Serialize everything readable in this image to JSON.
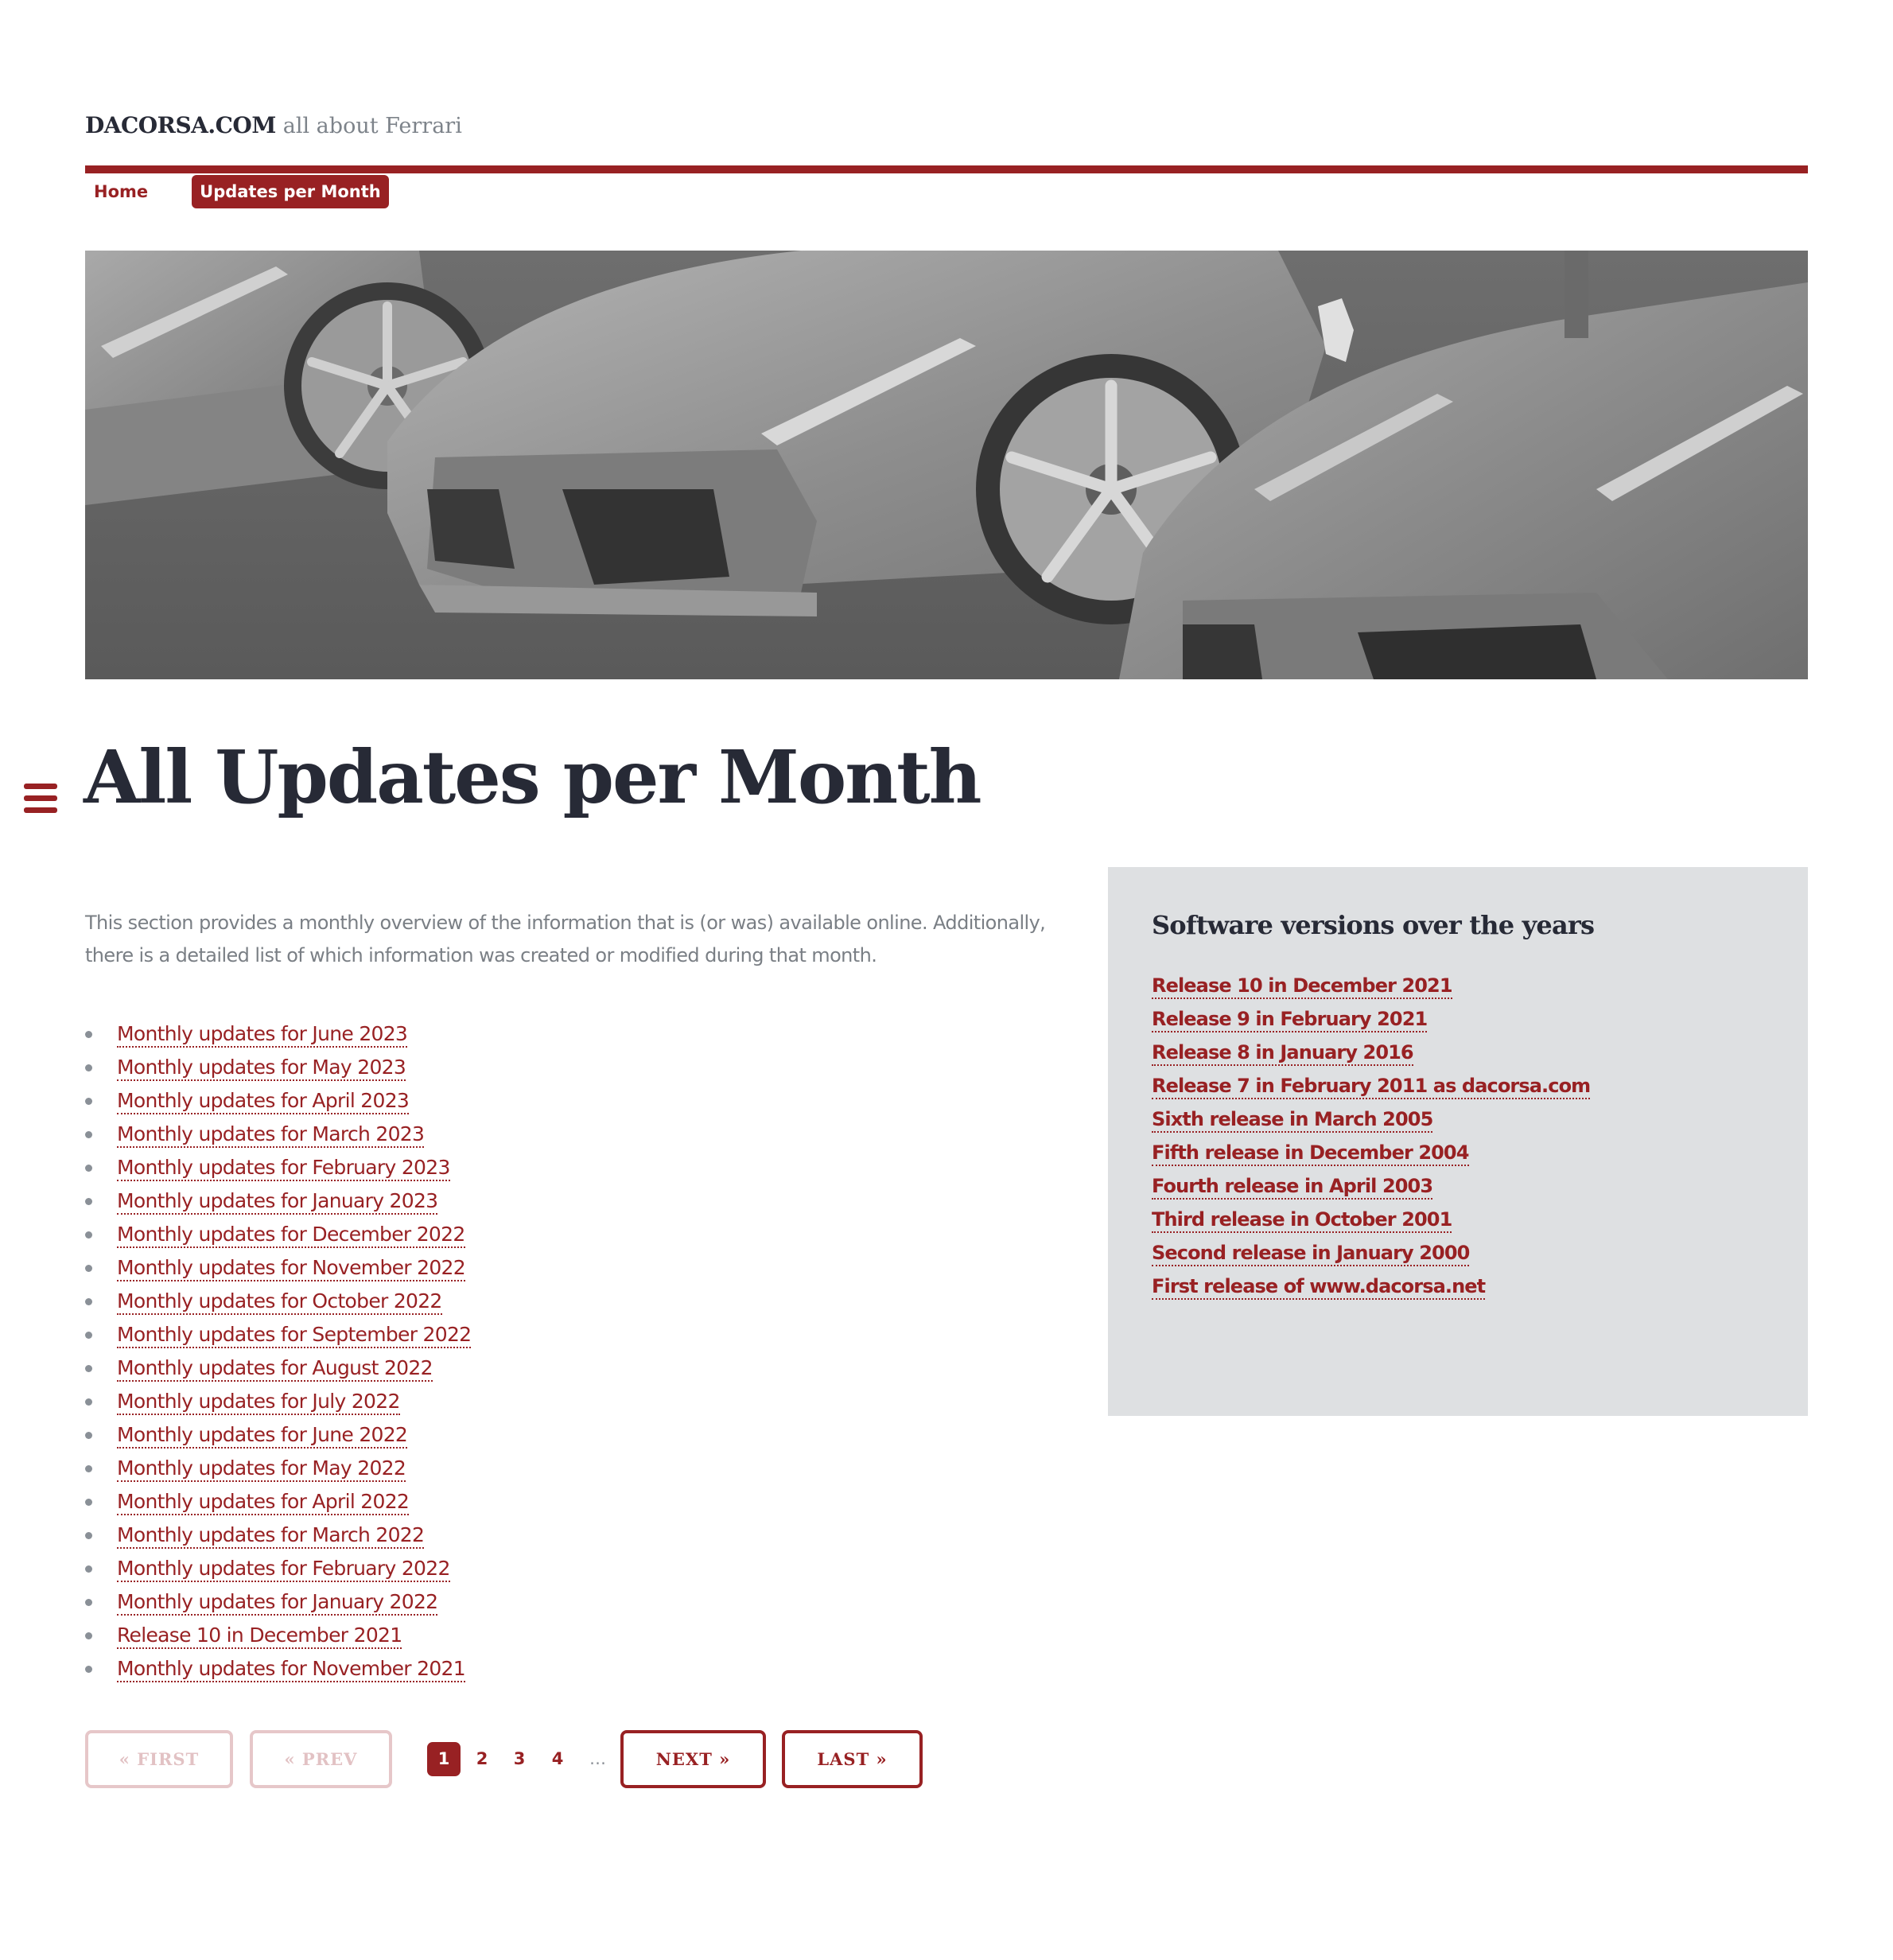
{
  "header": {
    "brand": "DACORSA.COM",
    "tagline": "all about Ferrari"
  },
  "nav": {
    "items": [
      {
        "label": "Home",
        "active": false
      },
      {
        "label": "Updates per Month",
        "active": true
      }
    ]
  },
  "hero": {
    "alt": "Grayscale photo of several Ferrari Enzo cars parked in a row"
  },
  "page": {
    "title": "All Updates per Month",
    "menu_icon": "hamburger-menu-icon",
    "intro": "This section provides a monthly overview of the information that is (or was) available online. Additionally, there is a detailed list of which information was created or modified during that month."
  },
  "monthly_updates": [
    "Monthly updates for June 2023",
    "Monthly updates for May 2023",
    "Monthly updates for April 2023",
    "Monthly updates for March 2023",
    "Monthly updates for February 2023",
    "Monthly updates for January 2023",
    "Monthly updates for December 2022",
    "Monthly updates for November 2022",
    "Monthly updates for October 2022",
    "Monthly updates for September 2022",
    "Monthly updates for August 2022",
    "Monthly updates for July 2022",
    "Monthly updates for June 2022",
    "Monthly updates for May 2022",
    "Monthly updates for April 2022",
    "Monthly updates for March 2022",
    "Monthly updates for February 2022",
    "Monthly updates for January 2022",
    "Release 10 in December 2021",
    "Monthly updates for November 2021"
  ],
  "sidebar": {
    "title": "Software versions over the years",
    "releases": [
      "Release 10 in December 2021",
      "Release 9 in February 2021",
      "Release 8 in January 2016",
      "Release 7 in February 2011 as dacorsa.com",
      "Sixth release in March 2005",
      "Fifth release in December 2004",
      "Fourth release in April 2003",
      "Third release in October 2001",
      "Second release in January 2000",
      "First release of www.dacorsa.net"
    ]
  },
  "pagination": {
    "first": "« FIRST",
    "prev": "« PREV",
    "pages": [
      "1",
      "2",
      "3",
      "4"
    ],
    "current_page": "1",
    "ellipsis": "…",
    "next": "NEXT »",
    "last": "LAST »",
    "first_disabled": true,
    "prev_disabled": true
  },
  "colors": {
    "accent": "#982123",
    "text_dark": "#272a36",
    "text_muted": "#7a7f85",
    "sidebar_bg": "#dee0e2",
    "disabled_border": "#e6c7c9"
  }
}
